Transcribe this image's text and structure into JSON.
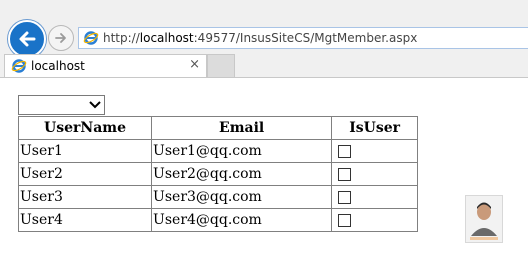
{
  "browser": {
    "url_prefix": "http://",
    "url_host": "localhost",
    "url_rest": ":49577/InsusSiteCS/MgtMember.aspx",
    "tab_title": "localhost",
    "tab_close": "×"
  },
  "page": {
    "dropdown_value": "",
    "table": {
      "headers": [
        "UserName",
        "Email",
        "IsUser"
      ],
      "rows": [
        {
          "username": "User1",
          "email": "User1@qq.com",
          "is_user": false
        },
        {
          "username": "User2",
          "email": "User2@qq.com",
          "is_user": false
        },
        {
          "username": "User3",
          "email": "User3@qq.com",
          "is_user": false
        },
        {
          "username": "User4",
          "email": "User4@qq.com",
          "is_user": false
        }
      ]
    }
  },
  "icons": {
    "back": "back-arrow-icon",
    "forward": "forward-arrow-icon",
    "site": "ie-icon",
    "dropdown": "chevron-down-icon",
    "avatar": "user-avatar"
  },
  "colors": {
    "back_button": "#1a73c8",
    "address_border": "#a9c4e6",
    "chrome_bg": "#f0f0f0",
    "table_border": "#808080"
  }
}
